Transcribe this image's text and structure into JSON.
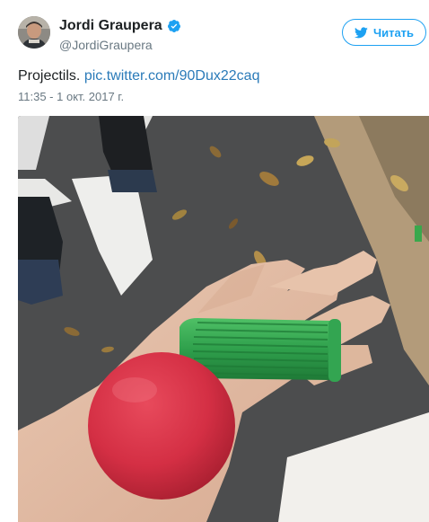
{
  "author": {
    "display_name": "Jordi Graupera",
    "handle": "@JordiGraupera",
    "verified": true,
    "avatar_icon": "avatar-photo"
  },
  "follow_button": {
    "label": "Читать",
    "icon": "twitter-bird-icon"
  },
  "tweet": {
    "text": "Projectils.",
    "link_text": "pic.twitter.com/90Dux22caq",
    "timestamp": "11:35 - 1 окт. 2017 г."
  },
  "colors": {
    "brand_blue": "#1da1f2",
    "link_blue": "#2b7bb9",
    "secondary_text": "#697882",
    "primary_text": "#1c2022"
  }
}
